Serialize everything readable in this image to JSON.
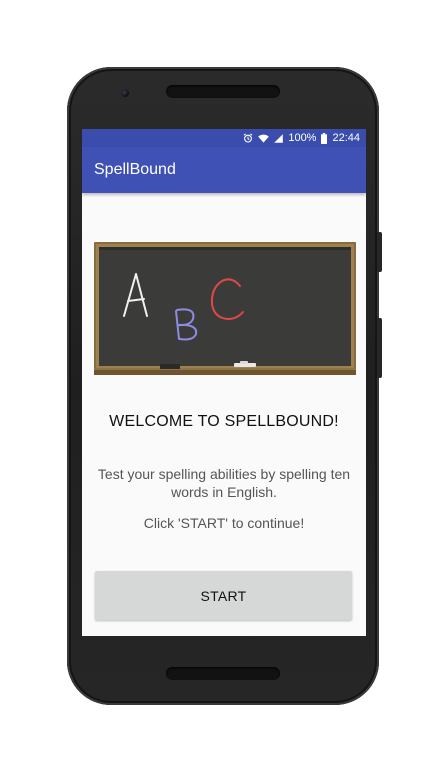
{
  "status_bar": {
    "battery": "100%",
    "time": "22:44",
    "icons": [
      "alarm-icon",
      "wifi-icon",
      "signal-icon",
      "battery-icon"
    ]
  },
  "app_bar": {
    "title": "SpellBound",
    "color": "#3f51b5"
  },
  "main": {
    "image": {
      "icon": "chalkboard-image",
      "letters": [
        "A",
        "B",
        "C"
      ]
    },
    "welcome": "WELCOME TO SPELLBOUND!",
    "description": "Test your spelling abilities by spelling ten words in English.",
    "instruction": "Click 'START' to continue!",
    "start_label": "START"
  },
  "colors": {
    "primary": "#3f51b5",
    "primary_dark": "#3a4dad",
    "button": "#d6d7d7",
    "background": "#fafafa"
  }
}
